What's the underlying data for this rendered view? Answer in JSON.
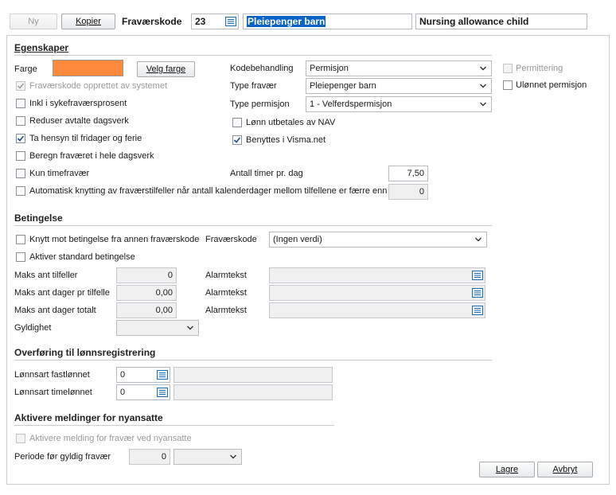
{
  "toolbar": {
    "new_label": "Ny",
    "copy_label": "Kopier",
    "code_label": "Fraværskode",
    "code_value": "23",
    "name_no": "Pleiepenger barn",
    "name_en": "Nursing allowance child"
  },
  "egenskaper": {
    "title": "Egenskaper",
    "color_label": "Farge",
    "choose_color_label": "Velg farge",
    "created_by_system_label": "Fraværskode opprettet av systemet",
    "sick_rate_label": "Inkl i sykefraværsprosent",
    "reduce_label": "Reduser avtalte dagsverk",
    "holidays_label": "Ta hensyn til fridager og ferie",
    "whole_day_label": "Beregn fraværet i hele dagsverk",
    "hourly_label": "Kun timefravær",
    "auto_link_label": "Automatisk knytting av fraværstilfeller når antall kalenderdager mellom tilfellene er færre enn",
    "auto_link_value": "0",
    "code_treatment_label": "Kodebehandling",
    "code_treatment_value": "Permisjon",
    "absence_type_label": "Type fravær",
    "absence_type_value": "Pleiepenger barn",
    "leave_type_label": "Type permisjon",
    "leave_type_value": "1 - Velferdspermisjon",
    "nav_label": "Lønn utbetales av NAV",
    "visma_label": "Benyttes i Visma.net",
    "hours_per_day_label": "Antall timer pr. dag",
    "hours_per_day_value": "7,50",
    "layoff_label": "Permittering",
    "unpaid_label": "Ulønnet permisjon"
  },
  "betingelse": {
    "title": "Betingelse",
    "link_cond_label": "Knytt mot betingelse fra annen fraværskode",
    "cond_code_label": "Fraværskode",
    "cond_code_value": "(Ingen verdi)",
    "std_cond_label": "Aktiver standard betingelse",
    "max_cases_label": "Maks ant tilfeller",
    "max_cases_value": "0",
    "max_days_case_label": "Maks ant dager pr tilfelle",
    "max_days_case_value": "0,00",
    "max_days_total_label": "Maks ant dager totalt",
    "max_days_total_value": "0,00",
    "alarm_label": "Alarmtekst",
    "validity_label": "Gyldighet"
  },
  "overforing": {
    "title": "Overføring til lønnsregistrering",
    "fixed_label": "Lønnsart fastlønnet",
    "fixed_value": "0",
    "hourly_label": "Lønnsart timelønnet",
    "hourly_value": "0"
  },
  "meldinger": {
    "title": "Aktivere meldinger for nyansatte",
    "activate_label": "Aktivere melding for fravær ved nyansatte",
    "period_label": "Periode før gyldig fravær",
    "period_value": "0"
  },
  "footer": {
    "save_label": "Lagre",
    "cancel_label": "Avbryt"
  },
  "colors": {
    "swatch": "#ff8a3c",
    "selection": "#0a64c8",
    "icon_blue": "#1f6fb2"
  }
}
